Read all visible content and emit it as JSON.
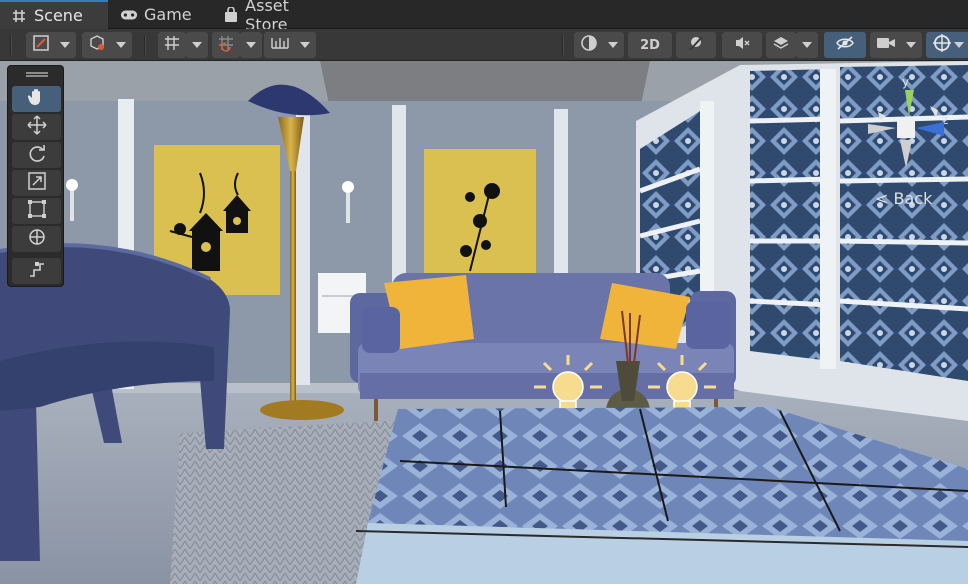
{
  "tabs": [
    {
      "label": "Scene",
      "icon": "grid-hash-icon"
    },
    {
      "label": "Game",
      "icon": "gamepad-icon"
    },
    {
      "label": "Asset Store",
      "icon": "shopping-bag-icon"
    }
  ],
  "toolbar": {
    "mode_2d_label": "2D",
    "left_group": [
      "draw-mode-icon",
      "shading-cube-icon",
      "grid-snap-icon",
      "increment-snap-icon",
      "ruler-icon"
    ],
    "right_group": [
      "render-sphere-icon",
      "2d-toggle",
      "lighting-icon",
      "audio-mute-icon",
      "effects-icon",
      "visibility-icon",
      "camera-icon",
      "gizmos-icon"
    ]
  },
  "tools": [
    "hand-icon",
    "move-icon",
    "rotate-icon",
    "scale-icon",
    "rect-icon",
    "transform-icon",
    "custom-tool-icon"
  ],
  "gizmo": {
    "view_label": "Back",
    "axes": [
      "y",
      "z"
    ],
    "colors": {
      "y": "#9ad15a",
      "z": "#3a6fd8",
      "x": "#cfcfcf"
    }
  },
  "scene": {
    "colors": {
      "wall": "#8d99a9",
      "floor": "#9aa3b2",
      "sofa": "#6a74a8",
      "pillow": "#f0b43a",
      "poster": "#d9c050",
      "shelf": "#2f4a6e",
      "table": "#5a6fa0"
    }
  }
}
